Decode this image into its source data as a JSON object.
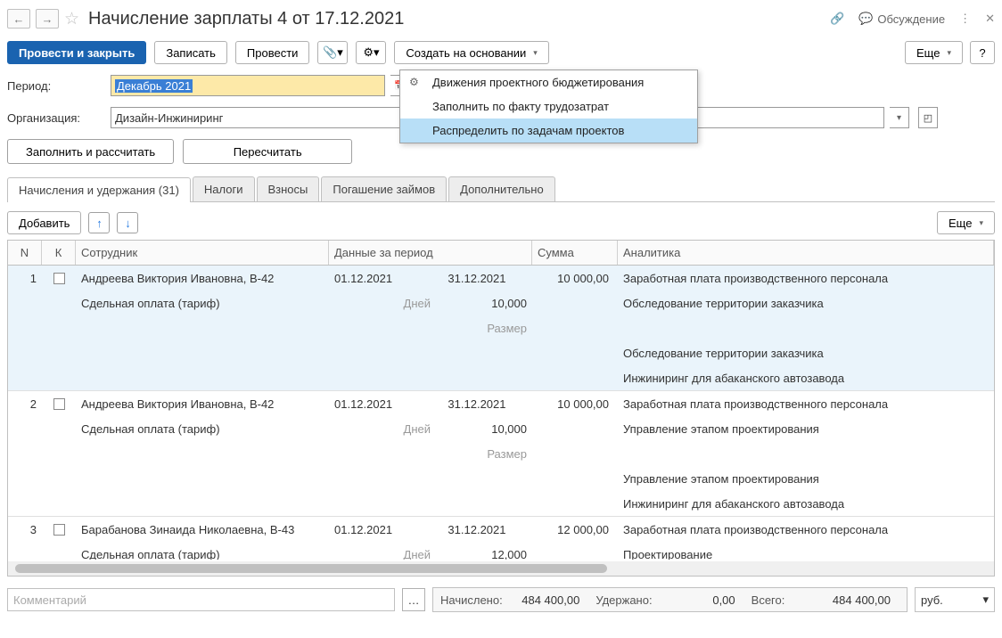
{
  "title": "Начисление зарплаты 4 от 17.12.2021",
  "header": {
    "discuss": "Обсуждение"
  },
  "toolbar": {
    "post_close": "Провести и закрыть",
    "save": "Записать",
    "post": "Провести",
    "create_based": "Создать на основании",
    "more": "Еще",
    "help": "?"
  },
  "menu": {
    "item1": "Движения проектного бюджетирования",
    "item2": "Заполнить по факту трудозатрат",
    "item3": "Распределить по задачам проектов"
  },
  "form": {
    "period_label": "Период:",
    "period_value": "Декабрь 2021",
    "org_label": "Организация:",
    "org_value": "Дизайн-Инжиниринг"
  },
  "actions": {
    "fill_calc": "Заполнить и рассчитать",
    "recalc": "Пересчитать"
  },
  "tabs": {
    "t1": "Начисления и удержания (31)",
    "t2": "Налоги",
    "t3": "Взносы",
    "t4": "Погашение займов",
    "t5": "Дополнительно"
  },
  "subtb": {
    "add": "Добавить",
    "more": "Еще"
  },
  "columns": {
    "n": "N",
    "k": "К",
    "emp": "Сотрудник",
    "data": "Данные за период",
    "sum": "Сумма",
    "an": "Аналитика"
  },
  "lbls": {
    "days": "Дней",
    "size": "Размер"
  },
  "rows": [
    {
      "n": "1",
      "emp": "Андреева Виктория Ивановна, В-42",
      "pay": "Сдельная оплата (тариф)",
      "d1": "01.12.2021",
      "d2": "31.12.2021",
      "days": "10,000",
      "sum": "10 000,00",
      "an": [
        "Заработная плата производственного персонала",
        "Обследование территории заказчика",
        "",
        "Обследование территории заказчика",
        "Инжиниринг для абаканского автозавода"
      ]
    },
    {
      "n": "2",
      "emp": "Андреева Виктория Ивановна, В-42",
      "pay": "Сдельная оплата (тариф)",
      "d1": "01.12.2021",
      "d2": "31.12.2021",
      "days": "10,000",
      "sum": "10 000,00",
      "an": [
        "Заработная плата производственного персонала",
        "Управление этапом проектирования",
        "",
        "Управление этапом проектирования",
        "Инжиниринг для абаканского автозавода"
      ]
    },
    {
      "n": "3",
      "emp": "Барабанова Зинаида Николаевна, В-43",
      "pay": "Сдельная оплата (тариф)",
      "d1": "01.12.2021",
      "d2": "31.12.2021",
      "days": "12,000",
      "sum": "12 000,00",
      "an": [
        "Заработная плата производственного персонала",
        "Проектирование"
      ]
    }
  ],
  "footer": {
    "comment_ph": "Комментарий",
    "accrued_lbl": "Начислено:",
    "accrued": "484 400,00",
    "withheld_lbl": "Удержано:",
    "withheld": "0,00",
    "total_lbl": "Всего:",
    "total": "484 400,00",
    "unit": "руб."
  }
}
